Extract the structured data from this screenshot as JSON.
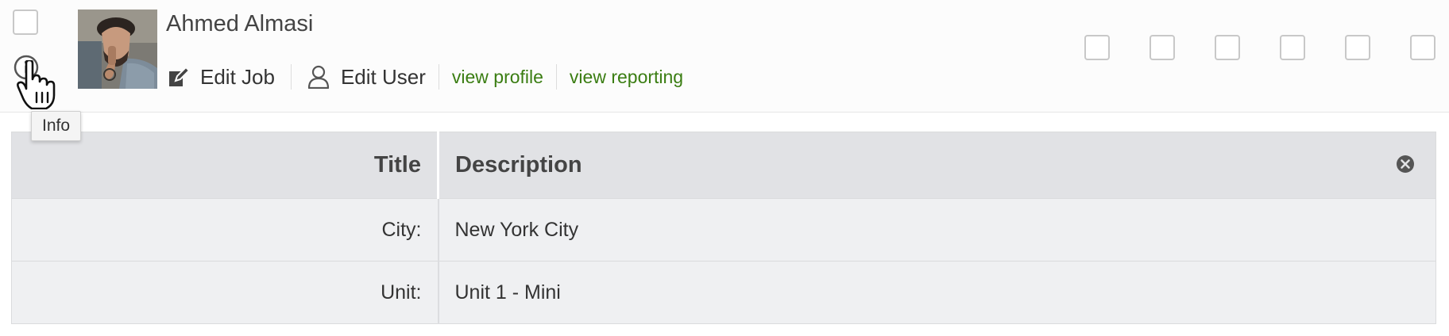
{
  "user": {
    "name": "Ahmed Almasi"
  },
  "actions": {
    "edit_job": "Edit Job",
    "edit_user": "Edit User",
    "view_profile": "view profile",
    "view_reporting": "view reporting"
  },
  "tooltip": {
    "text": "Info"
  },
  "details": {
    "header_title": "Title",
    "header_description": "Description",
    "rows": [
      {
        "label": "City:",
        "value": "New York City"
      },
      {
        "label": "Unit:",
        "value": "Unit 1 - Mini"
      }
    ]
  },
  "icons": {
    "edit_job": "pencil-icon",
    "edit_user": "user-icon",
    "info": "info-icon",
    "close": "close-circle-icon",
    "cursor": "hand-pointer-icon"
  },
  "colors": {
    "link": "#3a7d12",
    "table_header": "#e1e2e5",
    "table_row": "#eff0f2"
  }
}
